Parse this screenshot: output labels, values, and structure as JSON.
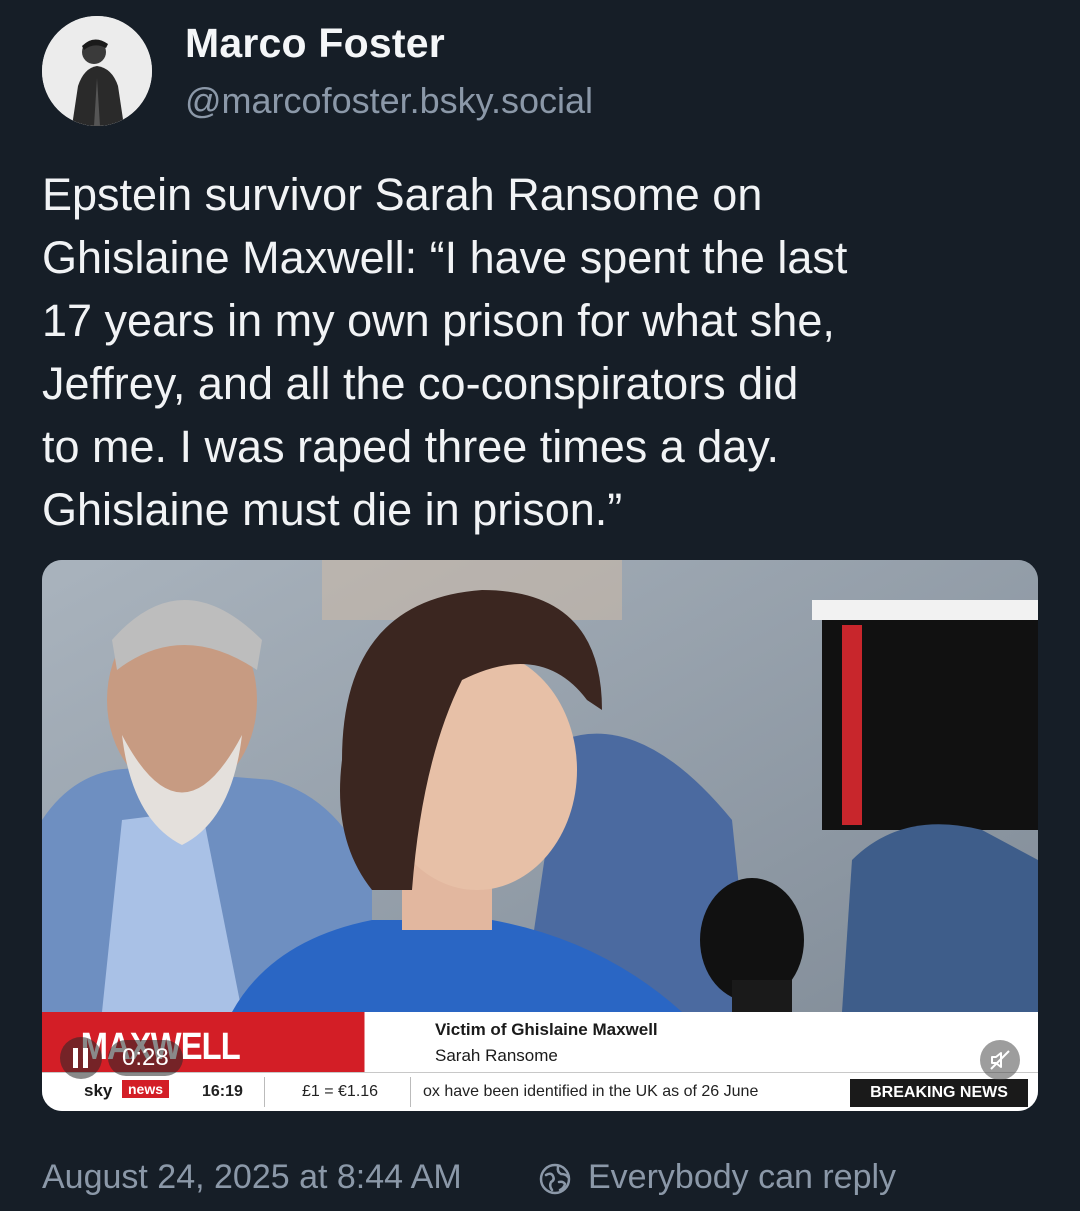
{
  "author": {
    "name": "Marco Foster",
    "handle": "@marcofoster.bsky.social"
  },
  "post": {
    "text": "Epstein survivor Sarah Ransome on\nGhislaine Maxwell: “I have spent the last\n17 years in my own prison for what she,\nJeffrey, and all the co-conspirators did\nto me. I was raped three times a day.\nGhislaine must die in prison.”"
  },
  "video": {
    "lower_third_title": "MAXWELL SENTENCING",
    "lower_third_line1": "Victim of Ghislaine Maxwell",
    "lower_third_line2": "Sarah Ransome",
    "ticker_brand": "sky",
    "ticker_brand_box": "news",
    "ticker_time": "16:19",
    "ticker_fx": "£1 = €1.16",
    "ticker_text": "ox have been identified in the UK as of 26 June",
    "breaking_label": "BREAKING NEWS",
    "elapsed": "0:28",
    "pause_icon": "pause-icon",
    "mute_icon": "speaker-muted-icon"
  },
  "footer": {
    "timestamp": "August 24, 2025 at 8:44 AM",
    "reply_setting": "Everybody can reply",
    "reply_icon": "globe-icon"
  },
  "colors": {
    "background": "#161e27",
    "muted_text": "#8b98a8",
    "sky_red": "#d31e26"
  }
}
